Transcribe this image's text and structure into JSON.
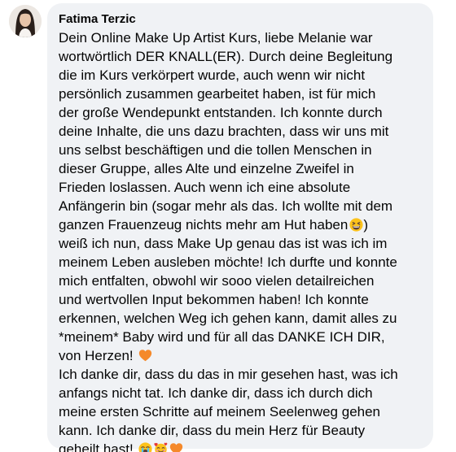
{
  "comment": {
    "author": "Fatima Terzic",
    "paragraph1": [
      "Dein Online Make Up Artist Kurs, liebe Melanie war",
      "wortwörtlich DER KNALL(ER). Durch deine Begleitung",
      "die im Kurs verkörpert wurde, auch wenn wir nicht",
      "persönlich zusammen gearbeitet haben, ist für mich",
      "der große Wendepunkt entstanden. Ich konnte durch",
      "deine Inhalte, die uns dazu brachten, dass wir uns mit",
      "uns selbst beschäftigen und die tollen Menschen in",
      "dieser Gruppe, alles Alte und einzelne Zweifel in",
      "Frieden loslassen. Auch wenn ich eine absolute",
      "Anfängerin bin (sogar mehr als das. Ich wollte mit dem",
      "ganzen Frauenzeug nichts mehr am Hut haben",
      "weiß ich nun, dass Make Up genau das ist was ich im",
      "meinem Leben ausleben möchte! Ich durfte und konnte",
      "mich entfalten, obwohl wir sooo vielen detailreichen",
      "und wertvollen Input bekommen haben! Ich konnte",
      "erkennen, welchen Weg ich gehen kann, damit alles zu",
      "*meinem* Baby wird und für all das DANKE ICH DIR,",
      "von Herzen!"
    ],
    "line11_suffix": ")",
    "paragraph2": [
      "Ich danke dir, dass du das in mir gesehen hast, was ich",
      "anfangs nicht tat. Ich danke dir, dass ich durch dich",
      "meine ersten Schritte auf meinem Seelenweg gehen",
      "kann. Ich danke dir, dass du mein Herz für Beauty",
      "geheilt hast!"
    ],
    "emojis": {
      "grin": "grinning-squinting-face-emoji",
      "heart": "orange-heart-emoji",
      "cry": "loudly-crying-face-emoji",
      "love": "smiling-face-with-hearts-emoji"
    },
    "colors": {
      "bubble": "#f0f2f5",
      "text": "#050505",
      "heart": "#f5892a",
      "emoji_face": "#fcc21b"
    }
  }
}
